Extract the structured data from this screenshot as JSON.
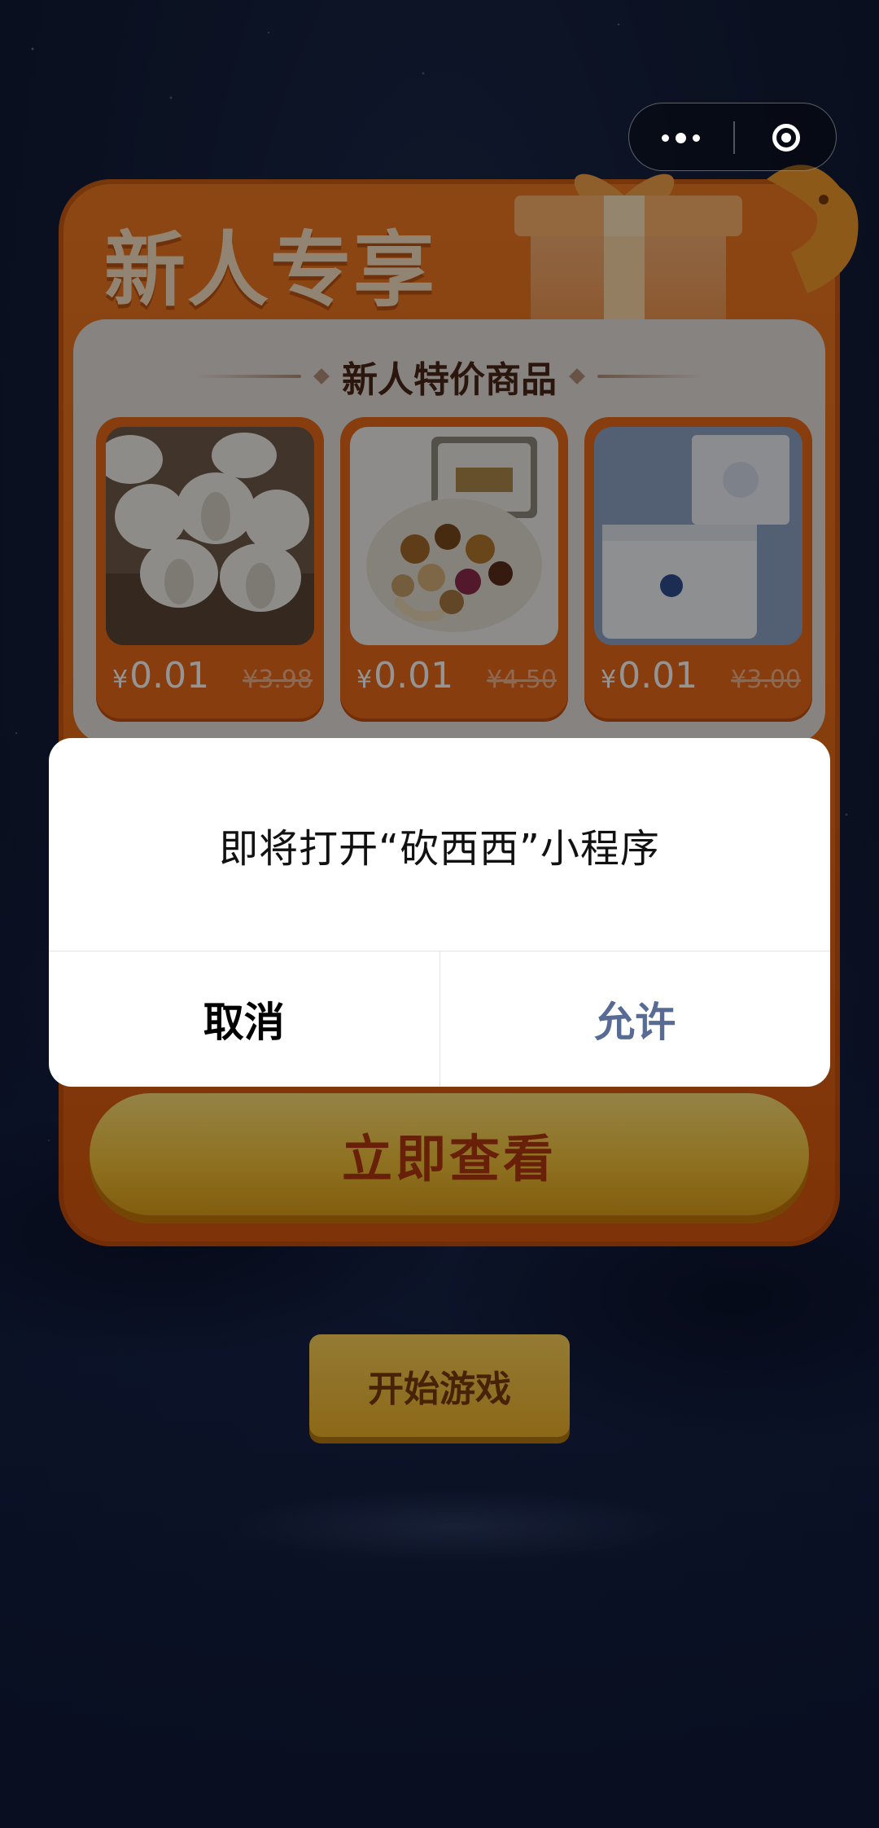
{
  "capsule": {
    "more_icon": "more-dots-icon",
    "close_icon": "target-close-icon"
  },
  "promo": {
    "title": "新人专享",
    "section_title": "新人特价商品",
    "products": [
      {
        "image": "garlic",
        "price": "0.01",
        "original_price": "¥3.98",
        "currency": "¥"
      },
      {
        "image": "mixed-nuts",
        "price": "0.01",
        "original_price": "¥4.50",
        "currency": "¥"
      },
      {
        "image": "tissue-pack",
        "price": "0.01",
        "original_price": "¥3.00",
        "currency": "¥"
      }
    ],
    "view_button": "立即查看"
  },
  "start_button": "开始游戏",
  "dialog": {
    "message": "即将打开“砍西西”小程序",
    "cancel": "取消",
    "allow": "允许"
  },
  "colors": {
    "accent_orange": "#e86a16",
    "dialog_allow": "#576b95",
    "background": "#15203d"
  }
}
